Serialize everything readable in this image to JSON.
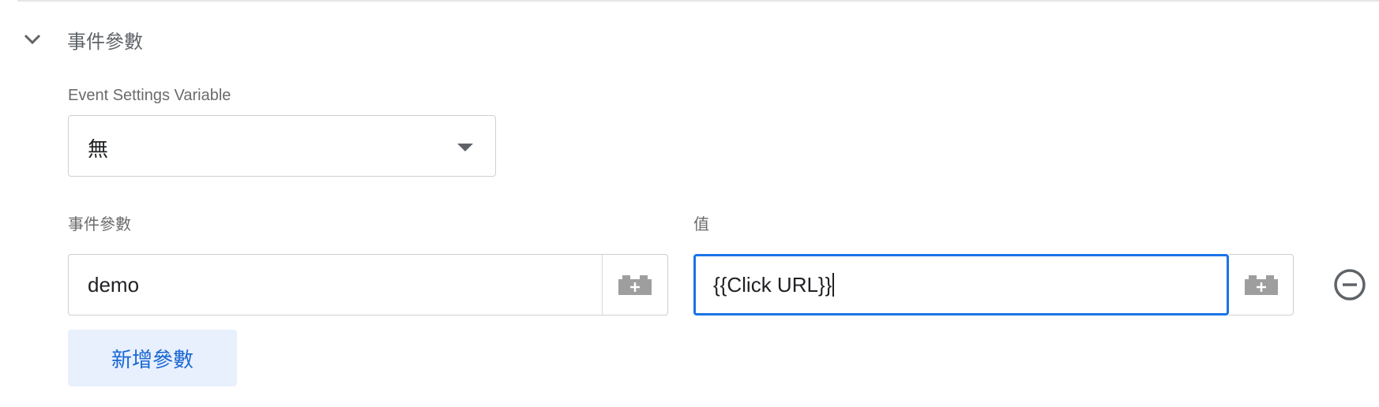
{
  "section": {
    "title": "事件參數",
    "icons": {
      "collapse": "chevron-down-icon"
    }
  },
  "settings_variable": {
    "label": "Event Settings Variable",
    "selected": "無"
  },
  "params": {
    "name_column_label": "事件參數",
    "value_column_label": "值",
    "rows": [
      {
        "name": "demo",
        "value": "{{Click URL}}"
      }
    ],
    "add_button_label": "新增參數",
    "icons": {
      "insert_variable": "variable-lego-plus-icon",
      "remove": "minus-circle-icon"
    }
  },
  "colors": {
    "focus": "#1a73e8",
    "button_bg": "#e8f0fe",
    "button_text": "#1967d2"
  }
}
